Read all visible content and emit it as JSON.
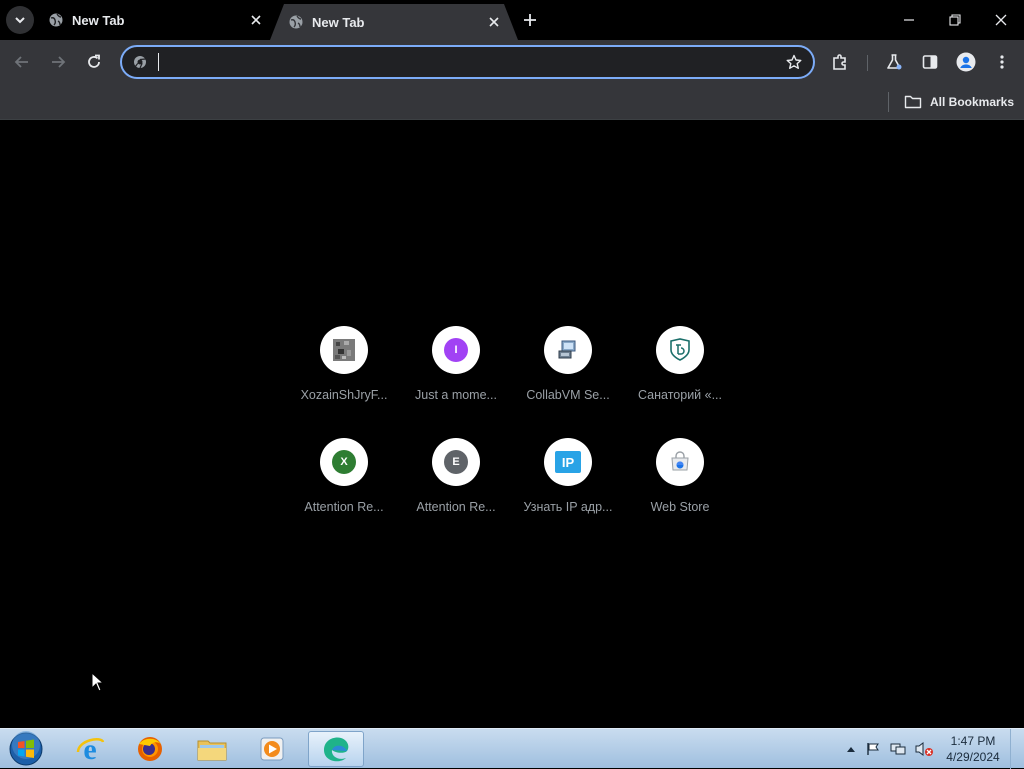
{
  "browser": {
    "tabs": [
      {
        "title": "New Tab",
        "active": false
      },
      {
        "title": "New Tab",
        "active": true
      }
    ],
    "omnibox": {
      "value": "",
      "placeholder": ""
    },
    "bookmarks": {
      "all_label": "All Bookmarks"
    }
  },
  "ntp": {
    "shortcuts": [
      {
        "label": "XozainShJryF...",
        "icon": "pixel-thumbnail-icon"
      },
      {
        "label": "Just a mome...",
        "icon": "letter-I-icon",
        "letter": "I",
        "color": "#a142f4"
      },
      {
        "label": "CollabVM Se...",
        "icon": "computer-icon"
      },
      {
        "label": "Санаторий «...",
        "icon": "shield-emblem-icon"
      },
      {
        "label": "Attention Re...",
        "icon": "letter-X-icon",
        "letter": "X",
        "color": "#2e7d32"
      },
      {
        "label": "Attention Re...",
        "icon": "letter-E-icon",
        "letter": "E",
        "color": "#5f6368"
      },
      {
        "label": "Узнать IP адр...",
        "icon": "ip-icon",
        "letter": "IP",
        "color": "#29a3e6"
      },
      {
        "label": "Web Store",
        "icon": "web-store-icon"
      }
    ]
  },
  "taskbar": {
    "apps": [
      "internet-explorer",
      "firefox",
      "file-explorer",
      "media-player",
      "edge-browser"
    ],
    "clock_time": "1:47 PM",
    "clock_date": "4/29/2024"
  }
}
